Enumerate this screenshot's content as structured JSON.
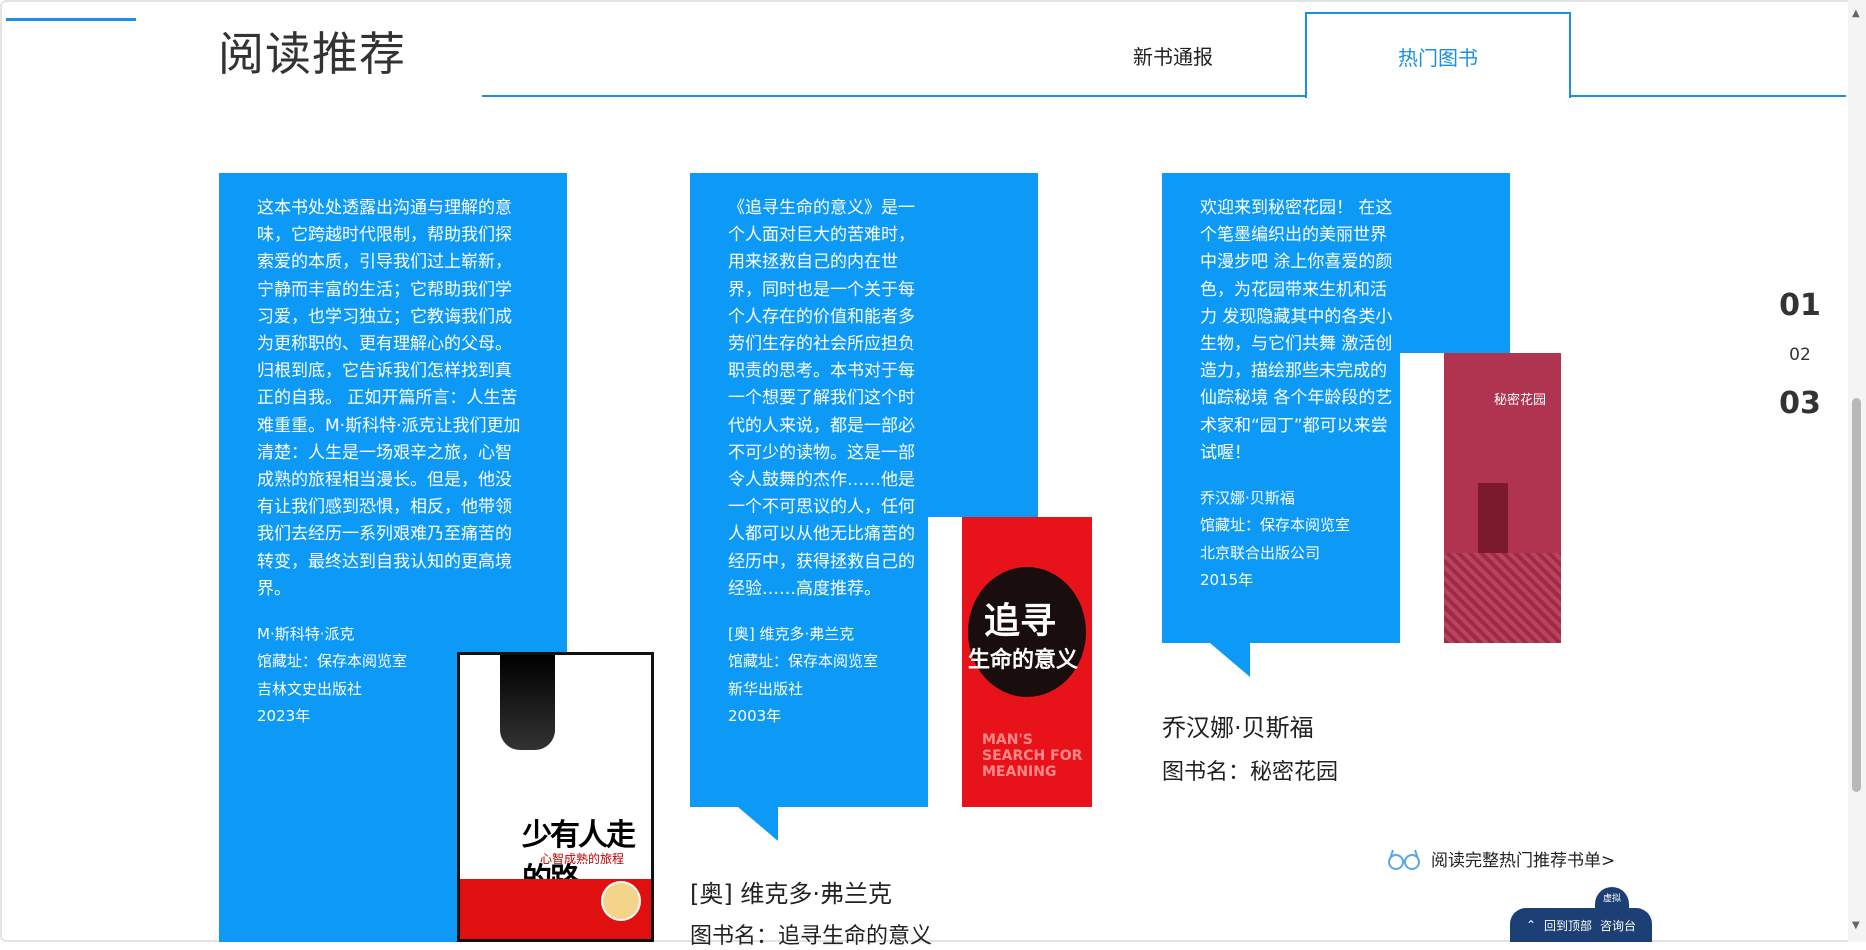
{
  "section": {
    "title": "阅读推荐",
    "tabs": [
      {
        "label": "新书通报",
        "active": false
      },
      {
        "label": "热门图书",
        "active": true
      }
    ]
  },
  "books": [
    {
      "description": "这本书处处透露出沟通与理解的意味，它跨越时代限制，帮助我们探索爱的本质，引导我们过上崭新，宁静而丰富的生活；它帮助我们学习爱，也学习独立；它教诲我们成为更称职的、更有理解心的父母。归根到底，它告诉我们怎样找到真正的自我。 正如开篇所言：人生苦难重重。M·斯科特·派克让我们更加清楚：人生是一场艰辛之旅，心智成熟的旅程相当漫长。但是，他没有让我们感到恐惧，相反，他带领我们去经历一系列艰难乃至痛苦的转变，最终达到自我认知的更高境界。",
      "author": "M·斯科特·派克",
      "location": "馆藏址：保存本阅览室",
      "publisher": "吉林文史出版社",
      "year": "2023年",
      "cover_title": "少有人走的路",
      "cover_subtitle": "心智成熟的旅程"
    },
    {
      "description": "《追寻生命的意义》是一个人面对巨大的苦难时，用来拯救自己的内在世界，同时也是一个关于每个人存在的价值和能者多劳们生存的社会所应担负职责的思考。本书对于每一个想要了解我们这个时代的人来说，都是一部必不可少的读物。这是一部令人鼓舞的杰作……他是一个不可思议的人，任何人都可以从他无比痛苦的经历中，获得拯救自己的经验……高度推荐。",
      "author": "[奥] 维克多·弗兰克",
      "location": "馆藏址：保存本阅览室",
      "publisher": "新华出版社",
      "year": "2003年",
      "below_author": "[奥] 维克多·弗兰克",
      "below_title": "图书名：追寻生命的意义",
      "cover_title1": "追寻",
      "cover_title2": "生命的意义",
      "cover_en": "MAN'S SEARCH FOR MEANING"
    },
    {
      "description": "欢迎来到秘密花园！ 在这个笔墨编织出的美丽世界中漫步吧 涂上你喜爱的颜色，为花园带来生机和活力 发现隐藏其中的各类小生物，与它们共舞 激活创造力，描绘那些未完成的仙踪秘境 各个年龄段的艺术家和“园丁”都可以来尝试喔！",
      "author": "乔汉娜·贝斯福",
      "location": "馆藏址：保存本阅览室",
      "publisher": "北京联合出版公司",
      "year": "2015年",
      "below_author": "乔汉娜·贝斯福",
      "below_title": "图书名：秘密花园",
      "cover_title": "秘密花园"
    }
  ],
  "full_list_link": "阅读完整热门推荐书单>",
  "pager": [
    "01",
    "02",
    "03"
  ],
  "float_bar": {
    "top": "回到顶部",
    "consult": "咨询台",
    "badge": "虚拟"
  },
  "colors": {
    "accent": "#1a8fe6",
    "card": "#0d9af7",
    "float": "#1c3f75"
  }
}
